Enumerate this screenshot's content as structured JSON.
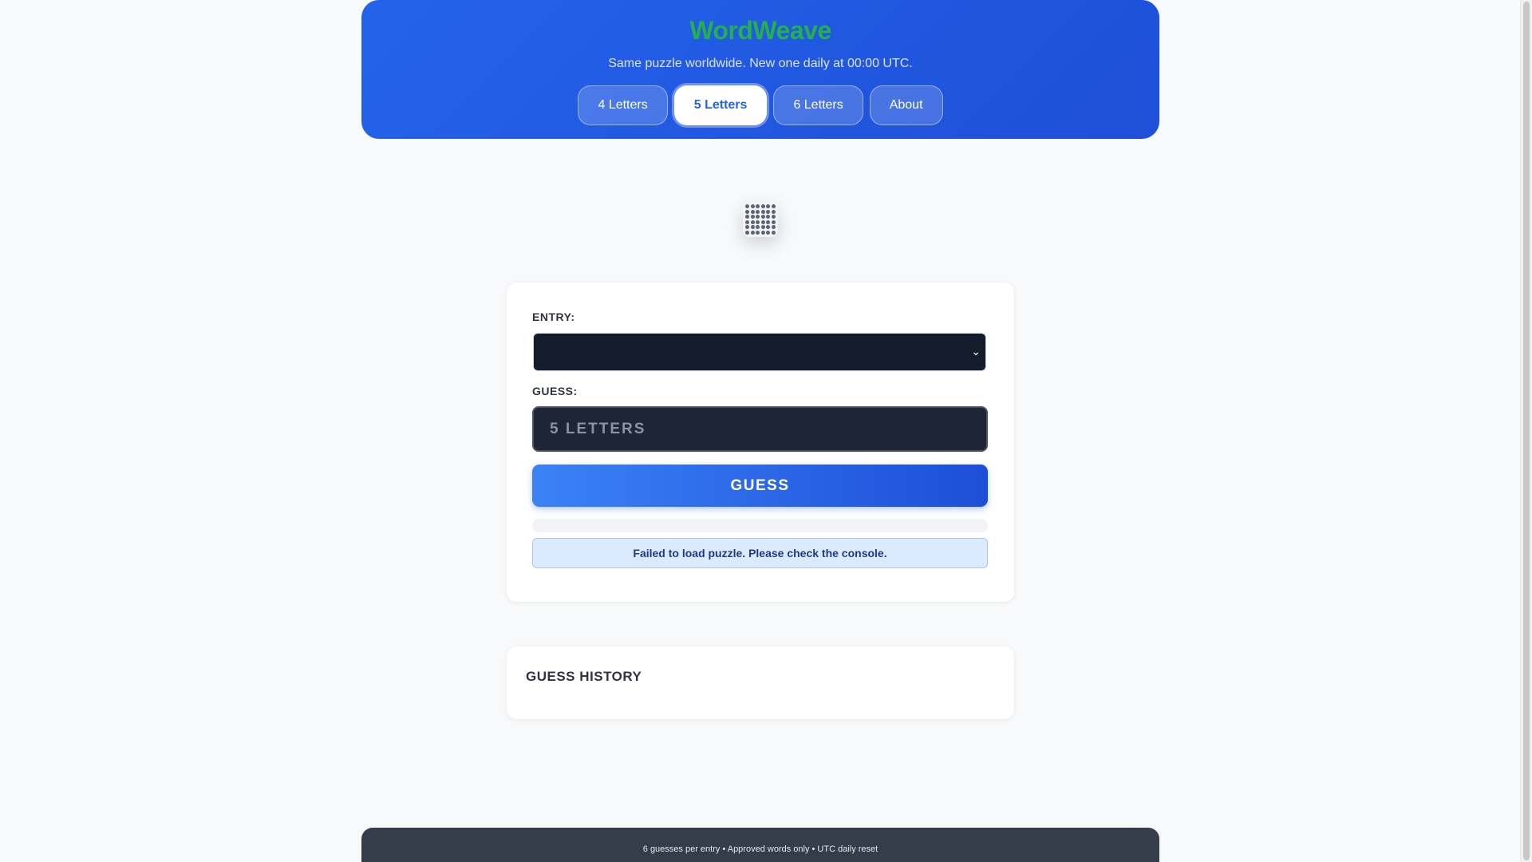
{
  "header": {
    "brand": "WordWeave",
    "tagline": "Same puzzle worldwide. New one daily at 00:00 UTC.",
    "nav": [
      {
        "label": "4 Letters",
        "active": false
      },
      {
        "label": "5 Letters",
        "active": true
      },
      {
        "label": "6 Letters",
        "active": false
      },
      {
        "label": "About",
        "active": false
      }
    ]
  },
  "logo": {
    "icon": "dot-grid-icon"
  },
  "form": {
    "entry_label": "ENTRY:",
    "entry_value": "",
    "guess_label": "GUESS:",
    "guess_placeholder": "5 LETTERS",
    "guess_button": "GUESS",
    "progress": 0,
    "error_message": "Failed to load puzzle. Please check the console."
  },
  "history": {
    "title": "GUESS HISTORY",
    "items": []
  },
  "footer": {
    "text": "6 guesses per entry • Approved words only • UTC daily reset"
  },
  "colors": {
    "header_bg": "#2563eb",
    "brand": "#22b14c",
    "button": "#3b82f6",
    "error_bg": "#dbeafe"
  }
}
